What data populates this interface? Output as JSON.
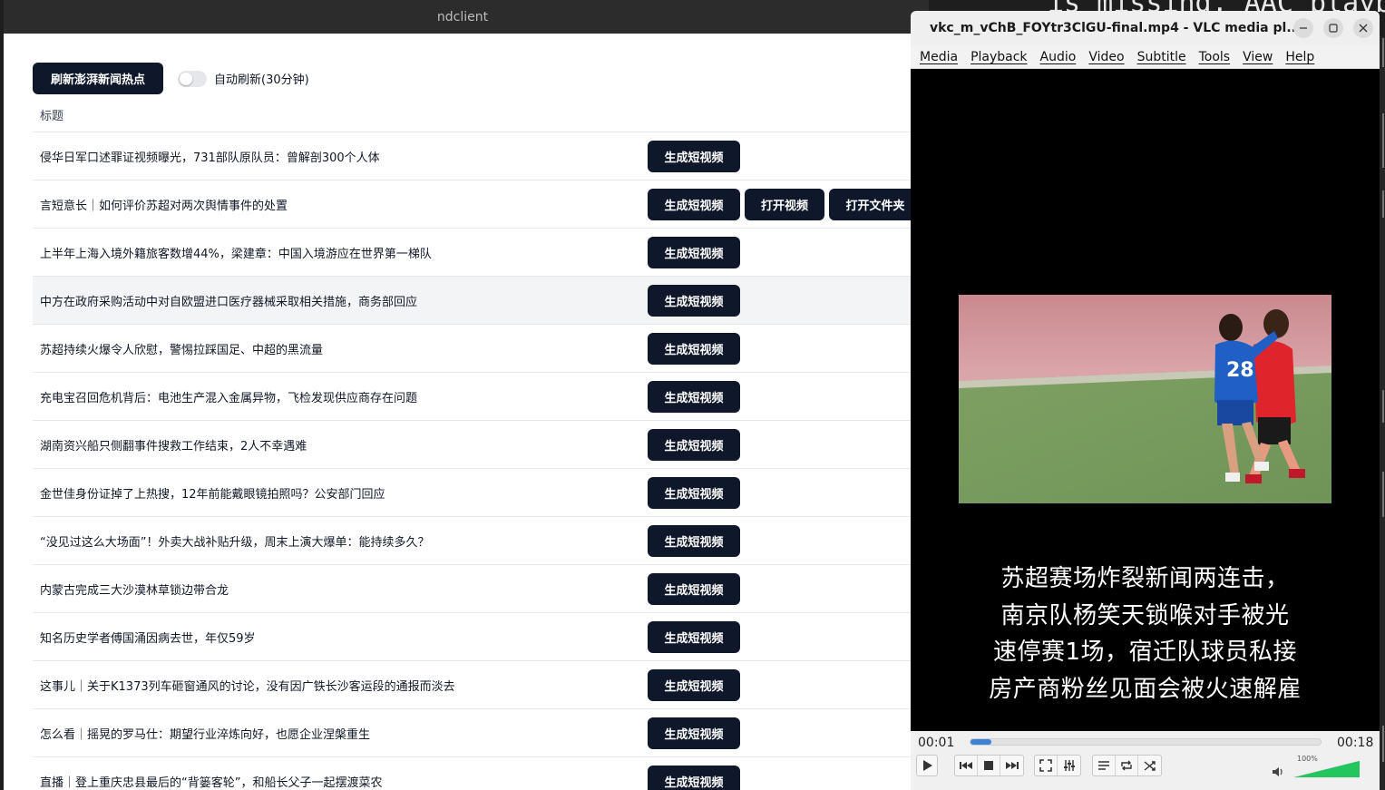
{
  "background": {
    "terminal_text": "is missing, AAC playba"
  },
  "nd": {
    "window_title": "ndclient",
    "refresh_label": "刷新澎湃新闻热点",
    "auto_refresh_label": "自动刷新(30分钟)",
    "auto_refresh_on": false,
    "column_title": "标题",
    "gen_label": "生成短视频",
    "open_label": "打开视频",
    "folder_label": "打开文件夹",
    "rows": [
      {
        "title": "侵华日军口述罪证视频曝光，731部队原队员：曾解剖300个人体"
      },
      {
        "title": "言短意长｜如何评价苏超对两次舆情事件的处置"
      },
      {
        "title": "上半年上海入境外籍旅客数增44%，梁建章：中国入境游应在世界第一梯队"
      },
      {
        "title": "中方在政府采购活动中对自欧盟进口医疗器械采取相关措施，商务部回应"
      },
      {
        "title": "苏超持续火爆令人欣慰，警惕拉踩国足、中超的黑流量"
      },
      {
        "title": "充电宝召回危机背后：电池生产混入金属异物，飞检发现供应商存在问题"
      },
      {
        "title": "湖南资兴船只侧翻事件搜救工作结束，2人不幸遇难"
      },
      {
        "title": "金世佳身份证掉了上热搜，12年前能戴眼镜拍照吗？公安部门回应"
      },
      {
        "title": "“没见过这么大场面”！外卖大战补贴升级，周末上演大爆单：能持续多久？"
      },
      {
        "title": "内蒙古完成三大沙漠林草锁边带合龙"
      },
      {
        "title": "知名历史学者傅国涌因病去世，年仅59岁"
      },
      {
        "title": "这事儿｜关于K1373列车砸窗通风的讨论，没有因广铁长沙客运段的通报而淡去"
      },
      {
        "title": "怎么看｜摇晃的罗马仕：期望行业淬炼向好，也愿企业涅槃重生"
      },
      {
        "title": "直播｜登上重庆忠县最后的“背篓客轮”，和船长父子一起摆渡菜农"
      }
    ]
  },
  "vlc": {
    "window_title": "vkc_m_vChB_FOYtr3ClGU-final.mp4 - VLC media pl...",
    "menu": [
      "Media",
      "Playback",
      "Audio",
      "Video",
      "Subtitle",
      "Tools",
      "View",
      "Help"
    ],
    "subtitle_lines": [
      "苏超赛场炸裂新闻两连击，",
      "南京队杨笑天锁喉对手被光",
      "速停赛1场，宿迁队球员私接",
      "房产商粉丝见面会被火速解雇"
    ],
    "jersey_number": "28",
    "time_elapsed": "00:01",
    "time_total": "00:18",
    "seek_fraction": 0.06,
    "volume_label": "100%",
    "volume_fraction": 1.0,
    "colors": {
      "accent": "#3b82d6",
      "volume": "#22c55e",
      "button": "#0f172a"
    }
  }
}
